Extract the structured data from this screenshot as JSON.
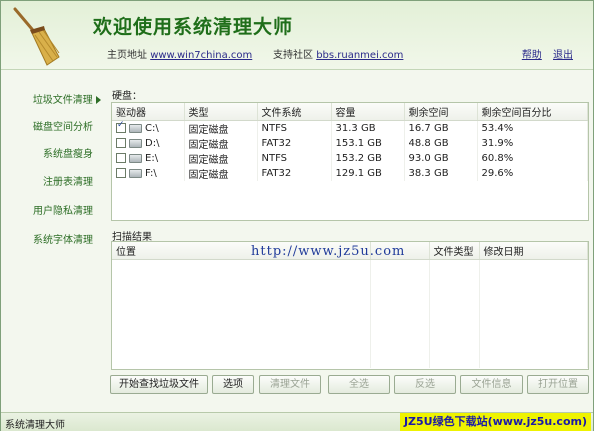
{
  "header": {
    "title": "欢迎使用系统清理大师",
    "homepage_label": "主页地址",
    "homepage_url": "www.win7china.com",
    "support_label": "支持社区",
    "support_url": "bbs.ruanmei.com",
    "help": "帮助",
    "exit": "退出"
  },
  "sidebar": {
    "items": [
      {
        "label": "垃圾文件清理",
        "active": true
      },
      {
        "label": "磁盘空间分析"
      },
      {
        "label": "系统盘瘦身"
      },
      {
        "label": "注册表清理"
      },
      {
        "label": "用户隐私清理"
      },
      {
        "label": "系统字体清理"
      }
    ]
  },
  "disk": {
    "section_label": "硬盘：",
    "columns": [
      "驱动器",
      "类型",
      "文件系统",
      "容量",
      "剩余空间",
      "剩余空间百分比"
    ],
    "rows": [
      {
        "checked": true,
        "drive": "C:\\",
        "type": "固定磁盘",
        "fs": "NTFS",
        "capacity": "31.3 GB",
        "free": "16.7 GB",
        "percent": "53.4%"
      },
      {
        "checked": false,
        "drive": "D:\\",
        "type": "固定磁盘",
        "fs": "FAT32",
        "capacity": "153.1 GB",
        "free": "48.8 GB",
        "percent": "31.9%"
      },
      {
        "checked": false,
        "drive": "E:\\",
        "type": "固定磁盘",
        "fs": "NTFS",
        "capacity": "153.2 GB",
        "free": "93.0 GB",
        "percent": "60.8%"
      },
      {
        "checked": false,
        "drive": "F:\\",
        "type": "固定磁盘",
        "fs": "FAT32",
        "capacity": "129.1 GB",
        "free": "38.3 GB",
        "percent": "29.6%"
      }
    ]
  },
  "scan": {
    "section_label": "扫描结果",
    "columns": [
      "位置",
      "",
      "文件类型",
      "修改日期"
    ],
    "watermark": "http://www.jz5u.com"
  },
  "buttons": {
    "start": "开始查找垃圾文件",
    "options": "选项",
    "clean": "清理文件",
    "select_all": "全选",
    "invert": "反选",
    "file_info": "文件信息",
    "open_location": "打开位置"
  },
  "status": {
    "text": "系统清理大师",
    "badge": "JZ5U绿色下载站(www.jz5u.com)"
  }
}
